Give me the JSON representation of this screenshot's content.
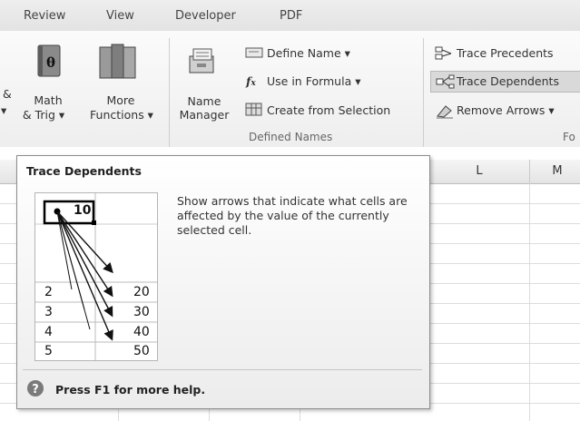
{
  "tabs": [
    "Review",
    "View",
    "Developer",
    "PDF"
  ],
  "ribbon": {
    "cut_left_1": "&",
    "cut_left_2": "▾",
    "math_line1": "Math",
    "math_line2": "& Trig ▾",
    "more_line1": "More",
    "more_line2": "Functions ▾",
    "name_line1": "Name",
    "name_line2": "Manager",
    "define_name": "Define Name ▾",
    "use_in_formula": "Use in Formula ▾",
    "create_from_selection": "Create from Selection",
    "defined_names_group": "Defined Names",
    "trace_precedents": "Trace Precedents",
    "trace_dependents": "Trace Dependents",
    "remove_arrows": "Remove Arrows ▾",
    "formula_group_cut": "Fo"
  },
  "grid": {
    "columns": [
      "L",
      "M"
    ]
  },
  "tooltip": {
    "title": "Trace Dependents",
    "description": "Show arrows that indicate what cells are affected by the value of the currently selected cell.",
    "help": "Press F1 for more help.",
    "demo": {
      "source": "10",
      "rows": [
        [
          "2",
          "20"
        ],
        [
          "3",
          "30"
        ],
        [
          "4",
          "40"
        ],
        [
          "5",
          "50"
        ]
      ]
    }
  },
  "colors": {
    "highlight": "#d9d9d9",
    "help_icon": "#7a7a7a"
  }
}
